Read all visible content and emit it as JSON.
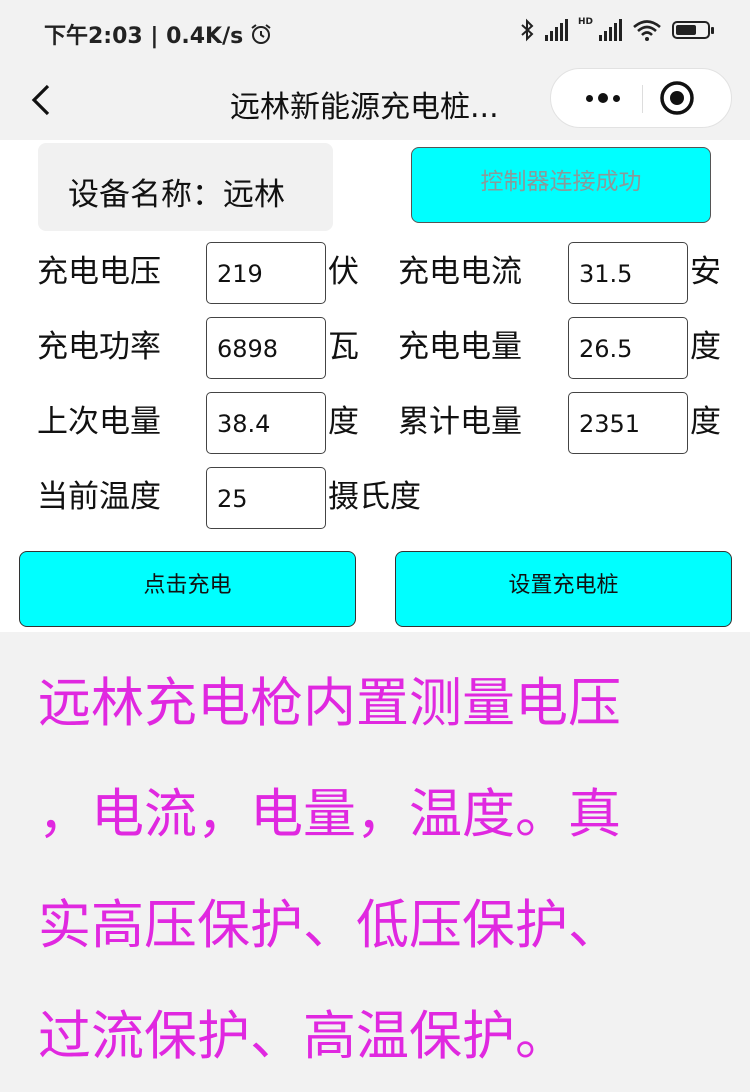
{
  "status_bar": {
    "time_speed": "下午2:03 | 0.4K/s",
    "hd_label": "HD",
    "icons": [
      "alarm-icon",
      "bluetooth-icon",
      "signal-icon",
      "signal-hd-icon",
      "wifi-icon",
      "battery-icon"
    ]
  },
  "nav": {
    "title": "远林新能源充电桩...",
    "back_icon": "chevron-left-icon",
    "more_icon": "more-dots-icon",
    "close_icon": "target-circle-icon"
  },
  "device": {
    "label": "设备名称：远林",
    "connect_status": "控制器连接成功"
  },
  "metrics": {
    "voltage": {
      "label": "充电电压",
      "value": "219",
      "unit": "伏"
    },
    "current": {
      "label": "充电电流",
      "value": "31.5",
      "unit": "安"
    },
    "power": {
      "label": "充电功率",
      "value": "6898",
      "unit": "瓦"
    },
    "energy": {
      "label": "充电电量",
      "value": "26.5",
      "unit": "度"
    },
    "last_energy": {
      "label": "上次电量",
      "value": "38.4",
      "unit": "度"
    },
    "total_energy": {
      "label": "累计电量",
      "value": "2351",
      "unit": "度"
    },
    "temperature": {
      "label": "当前温度",
      "value": "25",
      "unit": "摄氏度"
    }
  },
  "actions": {
    "charge": "点击充电",
    "settings": "设置充电桩"
  },
  "promo": {
    "lines": [
      "远林充电枪内置测量电压",
      "，电流，电量，温度。真",
      "实高压保护、低压保护、",
      "过流保护、高温保护。"
    ],
    "color": "#e028e0"
  },
  "colors": {
    "accent_button": "#00ffff",
    "page_bg": "#f2f2f2"
  }
}
